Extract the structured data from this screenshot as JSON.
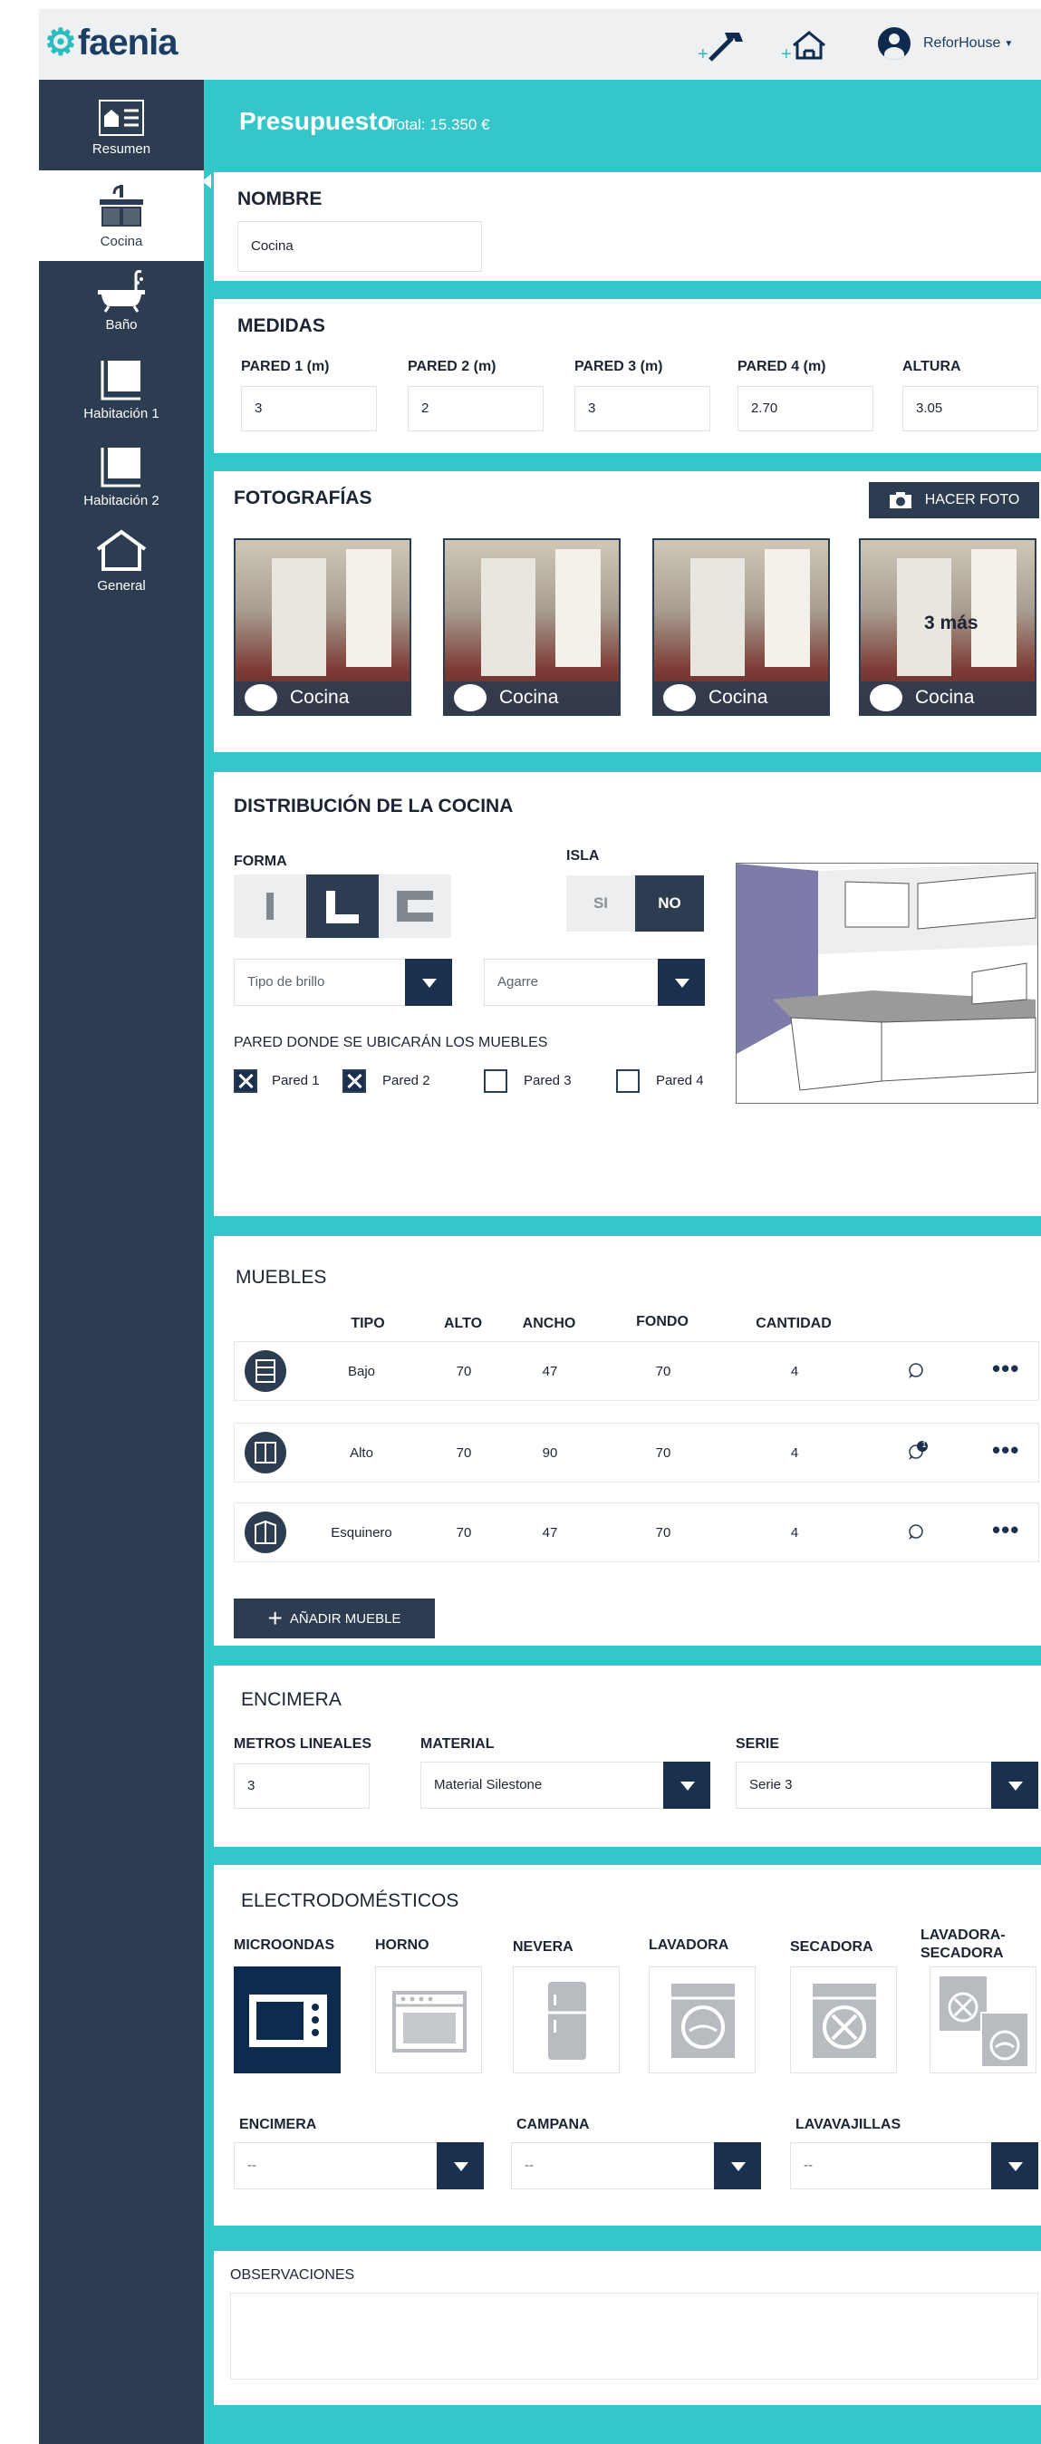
{
  "app": {
    "logo": "faenia",
    "user_name": "ReforHouse"
  },
  "colors": {
    "teal": "#34c6c8",
    "navy": "#2c3c51",
    "dark_navy": "#1b2f4f"
  },
  "sidebar": {
    "items": [
      {
        "label": "Resumen",
        "icon": "summary-icon"
      },
      {
        "label": "Cocina",
        "icon": "kitchen-sink-icon"
      },
      {
        "label": "Baño",
        "icon": "bathtub-icon"
      },
      {
        "label": "Habitación 1",
        "icon": "room-icon"
      },
      {
        "label": "Habitación 2",
        "icon": "room-icon"
      },
      {
        "label": "General",
        "icon": "house-icon"
      }
    ]
  },
  "header": {
    "title": "Presupuesto",
    "total": "Total: 15.350 €"
  },
  "nombre": {
    "title": "NOMBRE",
    "value": "Cocina"
  },
  "medidas": {
    "title": "MEDIDAS",
    "fields": [
      {
        "label": "PARED 1 (m)",
        "value": "3"
      },
      {
        "label": "PARED 2 (m)",
        "value": "2"
      },
      {
        "label": "PARED 3 (m)",
        "value": "3"
      },
      {
        "label": "PARED 4 (m)",
        "value": "2.70"
      },
      {
        "label": "ALTURA",
        "value": "3.05"
      }
    ]
  },
  "fotos": {
    "title": "FOTOGRAFÍAS",
    "button": "HACER FOTO",
    "items": [
      {
        "caption": "Cocina"
      },
      {
        "caption": "Cocina"
      },
      {
        "caption": "Cocina"
      },
      {
        "caption": "Cocina",
        "overlay": "3 más"
      }
    ]
  },
  "distribucion": {
    "title": "DISTRIBUCIÓN DE LA COCINA",
    "forma_label": "FORMA",
    "isla_label": "ISLA",
    "isla_si": "SI",
    "isla_no": "NO",
    "isla_selected": "NO",
    "brillo_placeholder": "Tipo de brillo",
    "agarre_placeholder": "Agarre",
    "pared_label": "PARED DONDE SE UBICARÁN LOS MUEBLES",
    "paredes": [
      {
        "label": "Pared 1",
        "checked": true
      },
      {
        "label": "Pared 2",
        "checked": true
      },
      {
        "label": "Pared 3",
        "checked": false
      },
      {
        "label": "Pared 4",
        "checked": false
      }
    ]
  },
  "muebles": {
    "title": "MUEBLES",
    "headers": [
      "TIPO",
      "ALTO",
      "ANCHO",
      "FONDO",
      "CANTIDAD"
    ],
    "rows": [
      {
        "tipo": "Bajo",
        "alto": "70",
        "ancho": "47",
        "fondo": "70",
        "cantidad": "4",
        "comments": ""
      },
      {
        "tipo": "Alto",
        "alto": "70",
        "ancho": "90",
        "fondo": "70",
        "cantidad": "4",
        "comments": "1"
      },
      {
        "tipo": "Esquinero",
        "alto": "70",
        "ancho": "47",
        "fondo": "70",
        "cantidad": "4",
        "comments": ""
      }
    ],
    "add_button": "AÑADIR MUEBLE"
  },
  "encimera": {
    "title": "ENCIMERA",
    "metros_label": "METROS LINEALES",
    "metros_value": "3",
    "material_label": "MATERIAL",
    "material_value": "Material Silestone",
    "serie_label": "SERIE",
    "serie_value": "Serie 3"
  },
  "electro": {
    "title": "ELECTRODOMÉSTICOS",
    "items": [
      "MICROONDAS",
      "HORNO",
      "NEVERA",
      "LAVADORA",
      "SECADORA",
      "LAVADORA-\nSECADORA"
    ],
    "selected": "MICROONDAS",
    "selects": [
      {
        "label": "ENCIMERA",
        "value": "--"
      },
      {
        "label": "CAMPANA",
        "value": "--"
      },
      {
        "label": "LAVAVAJILLAS",
        "value": "--"
      }
    ]
  },
  "observaciones": {
    "title": "OBSERVACIONES"
  }
}
